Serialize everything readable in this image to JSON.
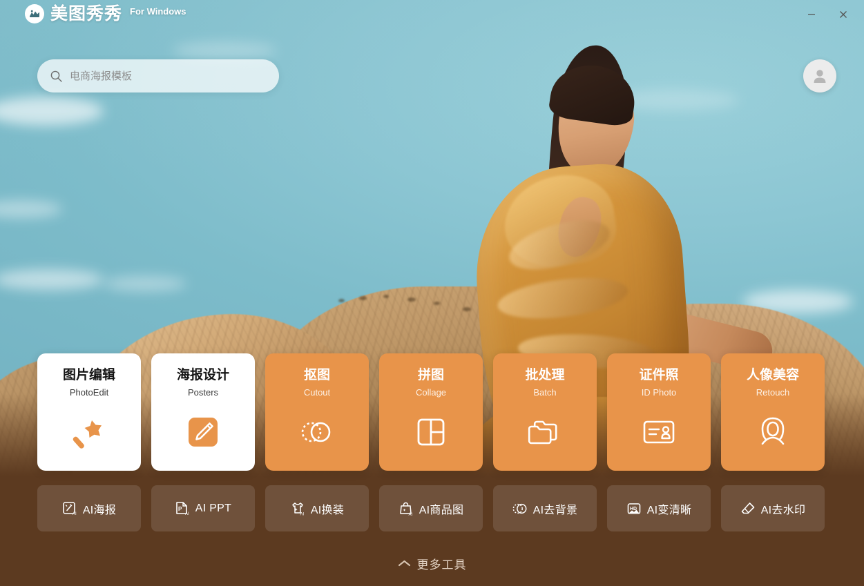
{
  "window": {
    "title": "美图秀秀 For Windows",
    "minimize_label": "minimize",
    "close_label": "close"
  },
  "brand": {
    "name": "美图秀秀",
    "suffix": "For Windows",
    "logo_icon": "meitu-logo-icon"
  },
  "search": {
    "placeholder": "电商海报模板",
    "value": "",
    "icon": "search-icon"
  },
  "account": {
    "avatar_icon": "user-avatar-icon"
  },
  "colors": {
    "accent": "#e8944a",
    "panel": "#5c3a20",
    "card_light": "#ffffff",
    "sky": "#8cc6d3"
  },
  "main_cards": [
    {
      "title": "图片编辑",
      "subtitle": "PhotoEdit",
      "icon": "magic-wand-icon",
      "style": "light"
    },
    {
      "title": "海报设计",
      "subtitle": "Posters",
      "icon": "pencil-square-icon",
      "style": "light"
    },
    {
      "title": "抠图",
      "subtitle": "Cutout",
      "icon": "cutout-circle-icon",
      "style": "accent"
    },
    {
      "title": "拼图",
      "subtitle": "Collage",
      "icon": "collage-grid-icon",
      "style": "accent"
    },
    {
      "title": "批处理",
      "subtitle": "Batch",
      "icon": "folders-icon",
      "style": "accent"
    },
    {
      "title": "证件照",
      "subtitle": "ID Photo",
      "icon": "id-card-icon",
      "style": "accent"
    },
    {
      "title": "人像美容",
      "subtitle": "Retouch",
      "icon": "portrait-face-icon",
      "style": "accent"
    }
  ],
  "ai_tools": [
    {
      "label": "AI海报",
      "icon": "ai-poster-icon"
    },
    {
      "label": "AI PPT",
      "icon": "ai-ppt-icon"
    },
    {
      "label": "AI换装",
      "icon": "ai-outfit-icon"
    },
    {
      "label": "AI商品图",
      "icon": "ai-product-icon"
    },
    {
      "label": "AI去背景",
      "icon": "ai-removebg-icon"
    },
    {
      "label": "AI变清晰",
      "icon": "ai-hd-icon"
    },
    {
      "label": "AI去水印",
      "icon": "ai-eraser-icon"
    }
  ],
  "more_tools": {
    "label": "更多工具",
    "icon": "chevron-up-icon"
  }
}
